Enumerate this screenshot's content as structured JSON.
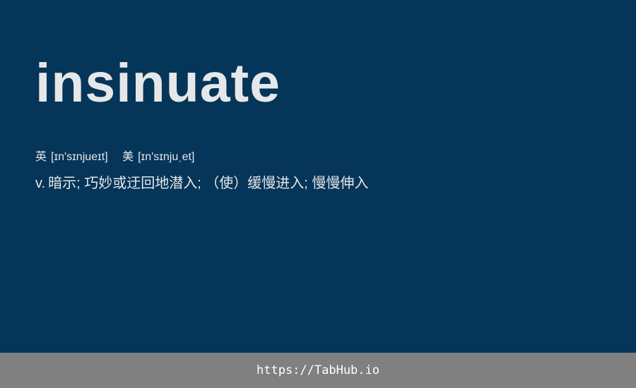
{
  "entry": {
    "word": "insinuate",
    "phonetics": {
      "uk_label": "英",
      "uk": "[ɪn'sɪnjueɪt]",
      "us_label": "美",
      "us": "[ɪn'sɪnjuˌet]"
    },
    "definition": {
      "pos": "v.",
      "text": "暗示; 巧妙或迂回地潜入; （使）缓慢进入; 慢慢伸入"
    }
  },
  "footer": {
    "link_text": "https://TabHub.io"
  },
  "colors": {
    "background": "#053559",
    "text": "#e6e7e9",
    "footer_bg": "#808080"
  }
}
